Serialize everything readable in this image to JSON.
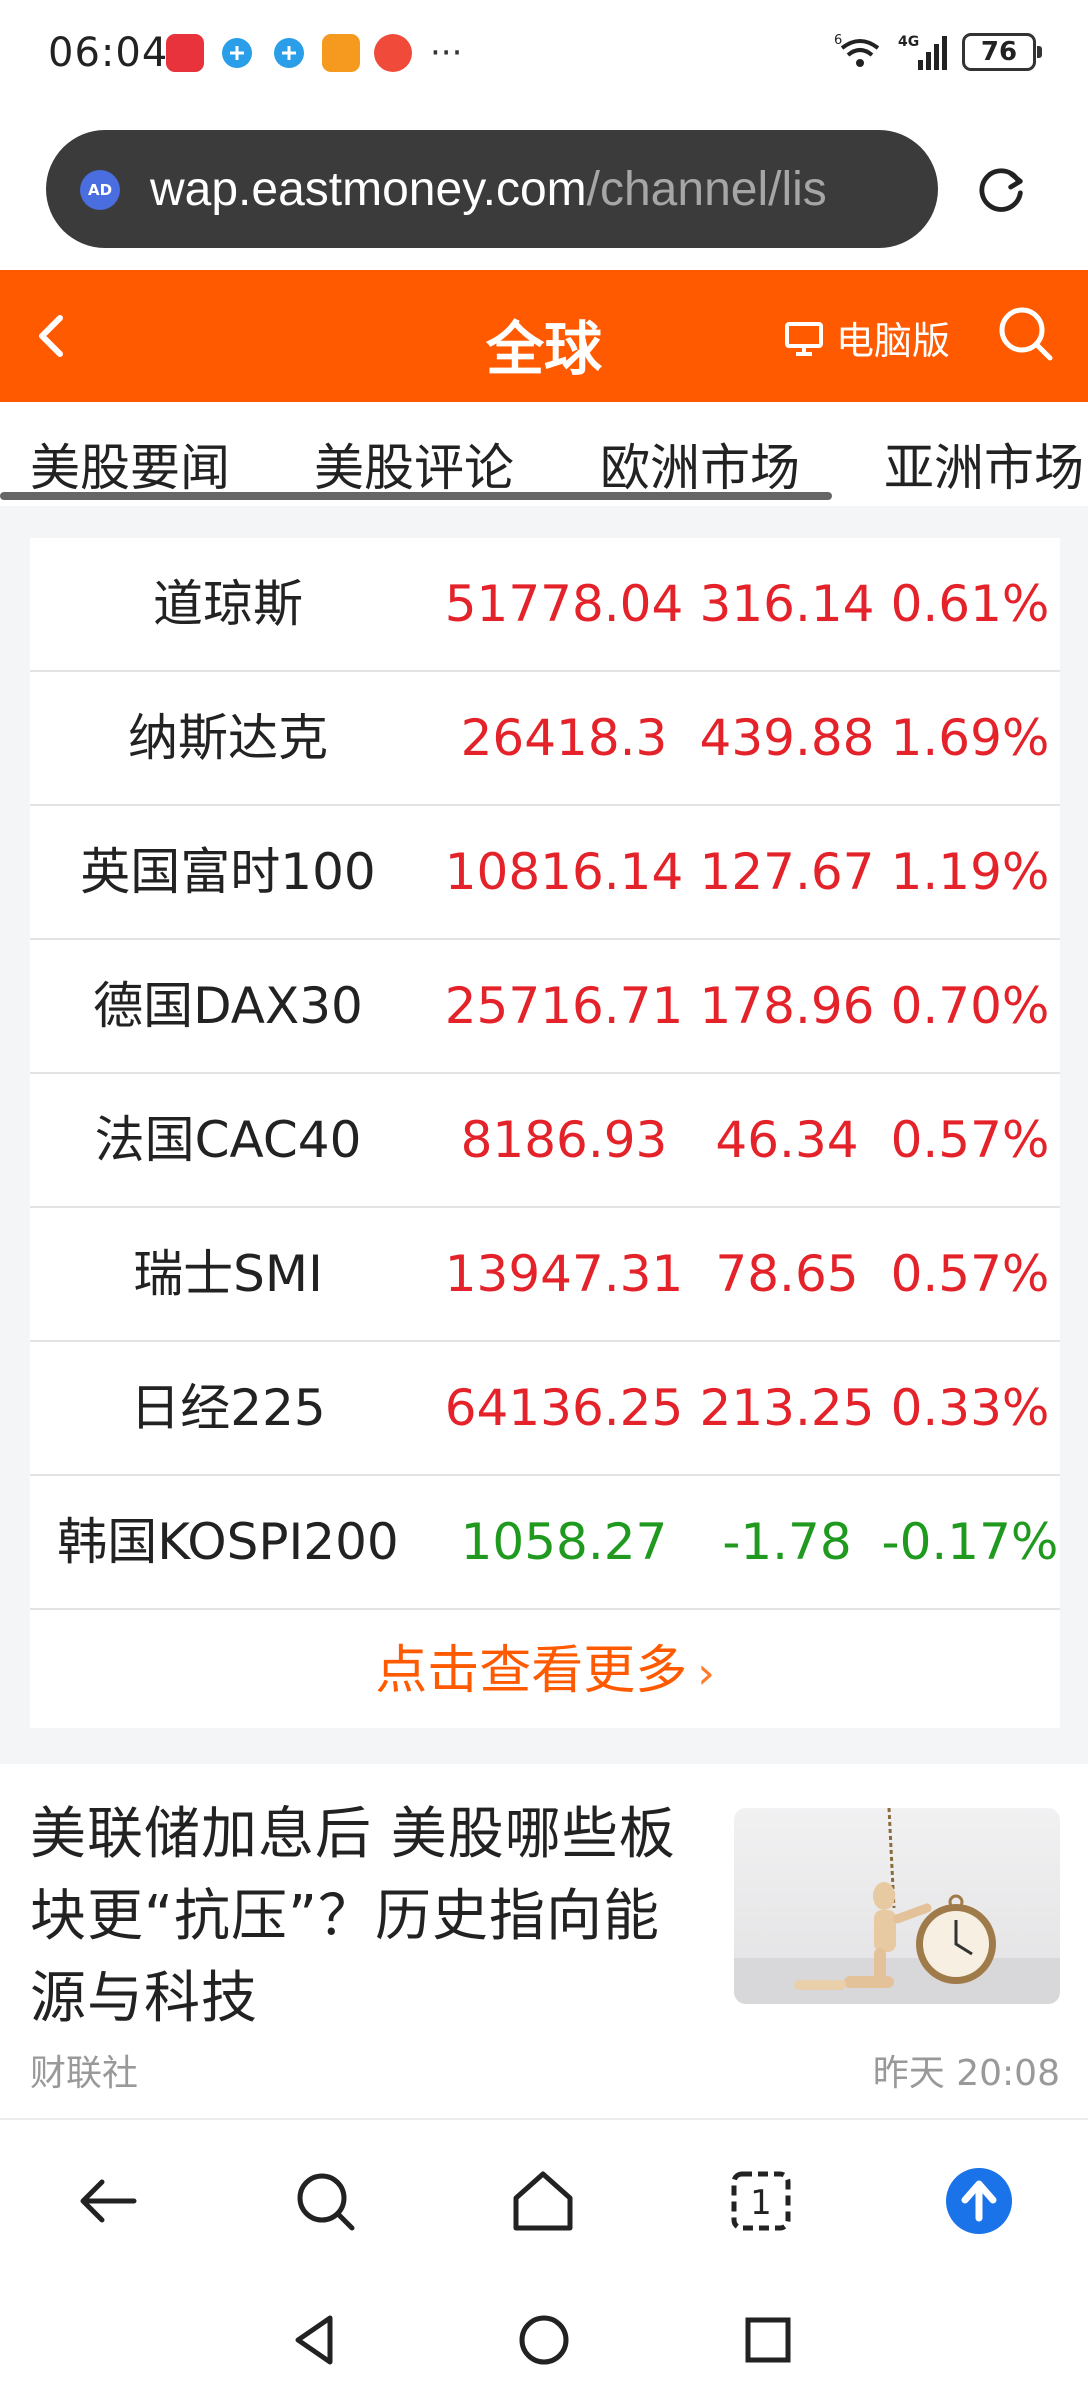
{
  "status_bar": {
    "time": "06:04",
    "network_sup": "6",
    "network_type": "4G",
    "battery": "76",
    "more_dots": "···"
  },
  "url_bar": {
    "ad_badge": "AD",
    "domain": "wap.eastmoney.com",
    "path": "/channel/lis"
  },
  "header": {
    "title": "全球",
    "pc_version_label": "电脑版",
    "brand_color": "#ff5a00"
  },
  "tabs": [
    {
      "label": "美股要闻"
    },
    {
      "label": "美股评论"
    },
    {
      "label": "欧洲市场"
    },
    {
      "label": "亚洲市场"
    }
  ],
  "indices": [
    {
      "name": "道琼斯",
      "value": "51778.04",
      "change": "316.14",
      "percent": "0.61%",
      "trend": "up"
    },
    {
      "name": "纳斯达克",
      "value": "26418.3",
      "change": "439.88",
      "percent": "1.69%",
      "trend": "up"
    },
    {
      "name": "英国富时100",
      "value": "10816.14",
      "change": "127.67",
      "percent": "1.19%",
      "trend": "up"
    },
    {
      "name": "德国DAX30",
      "value": "25716.71",
      "change": "178.96",
      "percent": "0.70%",
      "trend": "up"
    },
    {
      "name": "法国CAC40",
      "value": "8186.93",
      "change": "46.34",
      "percent": "0.57%",
      "trend": "up"
    },
    {
      "name": "瑞士SMI",
      "value": "13947.31",
      "change": "78.65",
      "percent": "0.57%",
      "trend": "up"
    },
    {
      "name": "日经225",
      "value": "64136.25",
      "change": "213.25",
      "percent": "0.33%",
      "trend": "up"
    },
    {
      "name": "韩国KOSPI200",
      "value": "1058.27",
      "change": "-1.78",
      "percent": "-0.17%",
      "trend": "down"
    }
  ],
  "more_link": {
    "label": "点击查看更多",
    "chevron": "›"
  },
  "news": [
    {
      "title": "美联储加息后 美股哪些板块更“抗压”？历史指向能源与科技",
      "source": "财联社",
      "time": "昨天 20:08",
      "thumbnail": "wooden-figure-pocket-watch-image"
    }
  ],
  "colors": {
    "up": "#e4222a",
    "down": "#1f9a1f",
    "accent": "#ff5a00",
    "upload_blue": "#1a73e8"
  },
  "toolbar": {
    "tab_count": "1"
  },
  "icons": [
    "back-arrow-icon",
    "refresh-icon",
    "monitor-icon",
    "search-icon",
    "home-icon",
    "tabs-icon",
    "upload-icon",
    "nav-back-icon",
    "nav-home-icon",
    "nav-recents-icon"
  ]
}
